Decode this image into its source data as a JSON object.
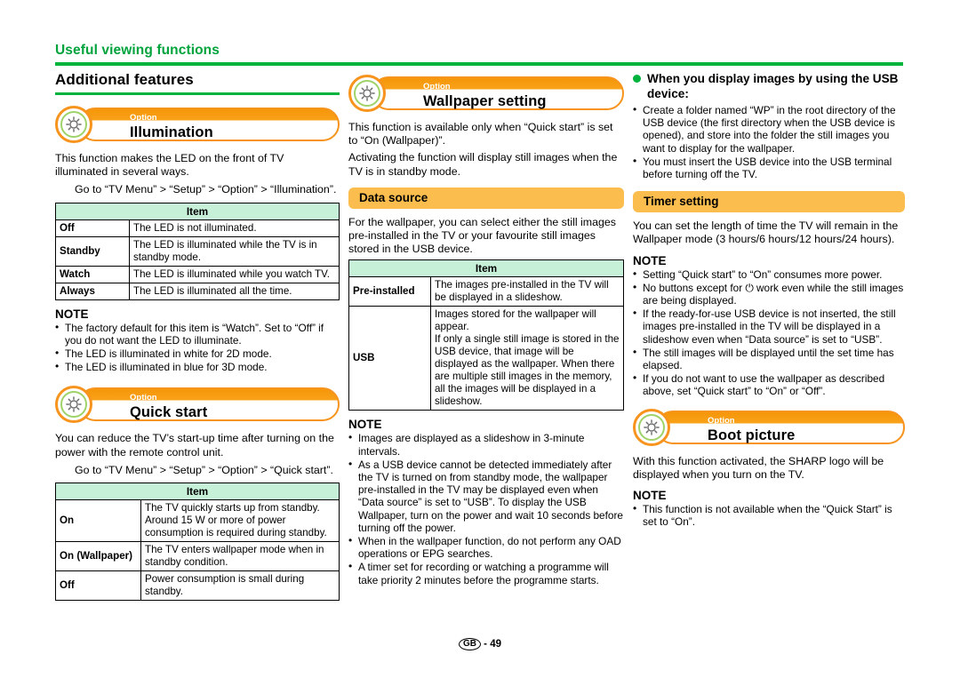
{
  "header": {
    "chapter_title": "Useful viewing functions"
  },
  "footer": {
    "region_code": "GB",
    "separator": "-",
    "page_number": "49"
  },
  "col1": {
    "section_title": "Additional features",
    "illumination": {
      "kicker": "Option",
      "name": "Illumination",
      "intro": "This function makes the LED on the front of TV illuminated in several ways.",
      "path": "Go to “TV Menu” > “Setup” > “Option” > “Illumination”.",
      "table": {
        "header": "Item",
        "rows": [
          {
            "key": "Off",
            "desc": "The LED is not illuminated."
          },
          {
            "key": "Standby",
            "desc": "The LED is illuminated while the TV is in standby mode."
          },
          {
            "key": "Watch",
            "desc": "The LED is illuminated while you watch TV."
          },
          {
            "key": "Always",
            "desc": "The LED is illuminated all the time."
          }
        ]
      },
      "note_title": "NOTE",
      "notes": [
        "The factory default for this item is “Watch”. Set to “Off” if you do not want the LED to illuminate.",
        "The LED is illuminated in white for 2D mode.",
        "The LED is illuminated in blue for 3D mode."
      ]
    },
    "quick_start": {
      "kicker": "Option",
      "name": "Quick start",
      "intro": "You can reduce the TV’s start-up time after turning on the power with the remote control unit.",
      "path": "Go to “TV Menu” > “Setup” > “Option” > “Quick start”.",
      "table": {
        "header": "Item",
        "rows": [
          {
            "key": "On",
            "desc": "The TV quickly starts up from standby. Around 15 W or more of power consumption is required during standby."
          },
          {
            "key": "On (Wallpaper)",
            "desc": "The TV enters wallpaper mode when in standby condition."
          },
          {
            "key": "Off",
            "desc": "Power consumption is small during standby."
          }
        ]
      }
    }
  },
  "col2": {
    "wallpaper_setting": {
      "kicker": "Option",
      "name": "Wallpaper setting",
      "intro1": "This function is available only when “Quick start” is set to “On (Wallpaper)”.",
      "intro2": "Activating the function will display still images when the TV is in standby mode.",
      "data_source": {
        "banner": "Data source",
        "intro": "For the wallpaper, you can select either the still images pre-installed in the TV or your favourite still images stored in the USB device.",
        "table": {
          "header": "Item",
          "rows": [
            {
              "key": "Pre-installed",
              "desc": "The images pre-installed in the TV will be displayed in a slideshow."
            },
            {
              "key": "USB",
              "desc": "Images stored for the wallpaper will appear.\nIf only a single still image is stored in the USB device, that image will be displayed as the wallpaper. When there are multiple still images in the memory, all the images will be displayed in a slideshow."
            }
          ]
        },
        "note_title": "NOTE",
        "notes": [
          "Images are displayed as a slideshow in 3-minute intervals.",
          "As a USB device cannot be detected immediately after the TV is turned on from standby mode, the wallpaper pre-installed in the TV may be displayed even when “Data source” is set to “USB”. To display the USB Wallpaper, turn on the power and wait 10 seconds before turning off the power.",
          "When in the wallpaper function, do not perform any OAD operations or EPG searches.",
          "A timer set for recording or watching a programme will take priority 2 minutes before the programme starts."
        ]
      }
    }
  },
  "col3": {
    "usb_display": {
      "heading": "When you display images by using the USB device:",
      "bullets": [
        "Create a folder named “WP” in the root directory of the USB device (the first directory when the USB device is opened), and store into the folder the still images you want to display for the wallpaper.",
        "You must insert the USB device into the USB terminal before turning off the TV."
      ]
    },
    "timer_setting": {
      "banner": "Timer setting",
      "intro": "You can set the length of time the TV will remain in the Wallpaper mode (3 hours/6 hours/12 hours/24 hours).",
      "note_title": "NOTE",
      "notes": [
        "Setting “Quick start” to “On” consumes more power.",
        "No buttons except for ⏻ work even while the still images are being displayed.",
        "If the ready-for-use USB device is not inserted, the still images pre-installed in the TV will be displayed in a slideshow even when “Data source” is set to “USB”.",
        "The still images will be displayed until the set time has elapsed.",
        "If you do not want to use the wallpaper as described above, set “Quick start” to “On” or “Off”."
      ]
    },
    "boot_picture": {
      "kicker": "Option",
      "name": "Boot picture",
      "intro": "With this function activated, the SHARP logo will be displayed when you turn on the TV.",
      "note_title": "NOTE",
      "notes": [
        "This function is not available when the “Quick Start” is set to “On”."
      ]
    }
  },
  "colors": {
    "green": "#00b33c",
    "orange": "#f7941e",
    "amber": "#fbbd4e",
    "table_header_green": "#c6f0d8"
  }
}
